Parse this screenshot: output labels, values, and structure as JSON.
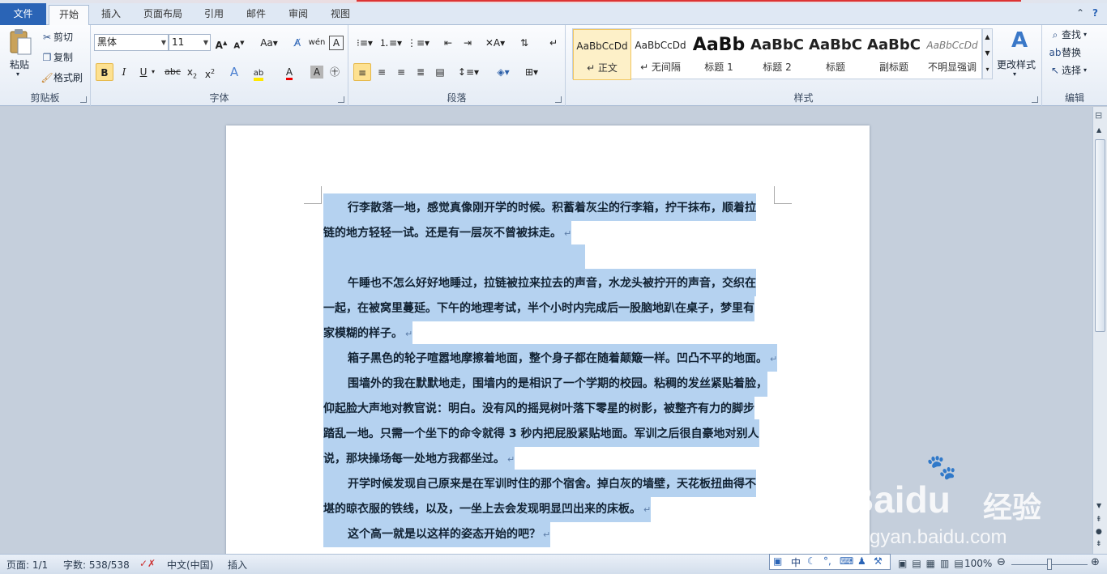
{
  "tabs": [
    "文件",
    "开始",
    "插入",
    "页面布局",
    "引用",
    "邮件",
    "审阅",
    "视图"
  ],
  "clipboard": {
    "paste": "粘贴",
    "cut": "剪切",
    "copy": "复制",
    "format_painter": "格式刷",
    "label": "剪贴板"
  },
  "font": {
    "name": "黑体",
    "size": "11",
    "label": "字体"
  },
  "paragraph": {
    "label": "段落"
  },
  "styles": {
    "label": "样式",
    "items": [
      {
        "preview": "AaBbCcDd",
        "name": "↵ 正文"
      },
      {
        "preview": "AaBbCcDd",
        "name": "↵ 无间隔"
      },
      {
        "preview": "AaBb",
        "name": "标题 1"
      },
      {
        "preview": "AaBbC",
        "name": "标题 2"
      },
      {
        "preview": "AaBbC",
        "name": "标题"
      },
      {
        "preview": "AaBbC",
        "name": "副标题"
      },
      {
        "preview": "AaBbCcDd",
        "name": "不明显强调"
      }
    ],
    "change": "更改样式"
  },
  "editing": {
    "find": "查找",
    "replace": "替换",
    "select": "选择",
    "label": "编辑"
  },
  "document": {
    "lines": [
      {
        "text": "行李散落一地，感觉真像刚开学的时候。积蓄着灰尘的行李箱，拧干抹布，顺着拉",
        "indent": true,
        "mark": false
      },
      {
        "text": "链的地方轻轻一试。还是有一层灰不曾被抹走。",
        "indent": false,
        "mark": true
      },
      {
        "text": "",
        "indent": false,
        "mark": false
      },
      {
        "text": "午睡也不怎么好好地睡过，拉链被拉来拉去的声音，水龙头被拧开的声音，交织在",
        "indent": true,
        "mark": false
      },
      {
        "text": "一起，在被窝里蔓延。下午的地理考试，半个小时内完成后一股脑地趴在桌子，梦里有",
        "indent": false,
        "mark": false
      },
      {
        "text": "家模糊的样子。",
        "indent": false,
        "mark": true
      },
      {
        "text": "箱子黑色的轮子喧嚣地摩擦着地面，整个身子都在随着颠簸一样。凹凸不平的地面。",
        "indent": true,
        "mark": true
      },
      {
        "text": "围墙外的我在默默地走，围墙内的是相识了一个学期的校园。粘稠的发丝紧贴着脸，",
        "indent": true,
        "mark": false
      },
      {
        "text": "仰起脸大声地对教官说：明白。没有风的摇晃树叶落下零星的树影，被整齐有力的脚步",
        "indent": false,
        "mark": false
      },
      {
        "text": "踏乱一地。只需一个坐下的命令就得 3 秒内把屁股紧贴地面。军训之后很自豪地对别人",
        "indent": false,
        "mark": false
      },
      {
        "text": "说，那块操场每一处地方我都坐过。",
        "indent": false,
        "mark": true
      },
      {
        "text": "开学时候发现自己原来是在军训时住的那个宿舍。掉白灰的墙壁，天花板扭曲得不",
        "indent": true,
        "mark": false
      },
      {
        "text": "堪的晾衣服的铁线，以及，一坐上去会发现明显凹出来的床板。",
        "indent": false,
        "mark": true
      },
      {
        "text": "这个高一就是以这样的姿态开始的吧？",
        "indent": true,
        "mark": true
      }
    ],
    "return_mark": "↵"
  },
  "status": {
    "page": "页面: 1/1",
    "words": "字数: 538/538",
    "lang": "中文(中国)",
    "mode": "插入",
    "zoom": "100%"
  },
  "ime": {
    "mode": "中"
  },
  "watermark": {
    "brand": "Bai",
    "paw": "du",
    "cn": "经验",
    "url": "jingyan.baidu.com"
  }
}
